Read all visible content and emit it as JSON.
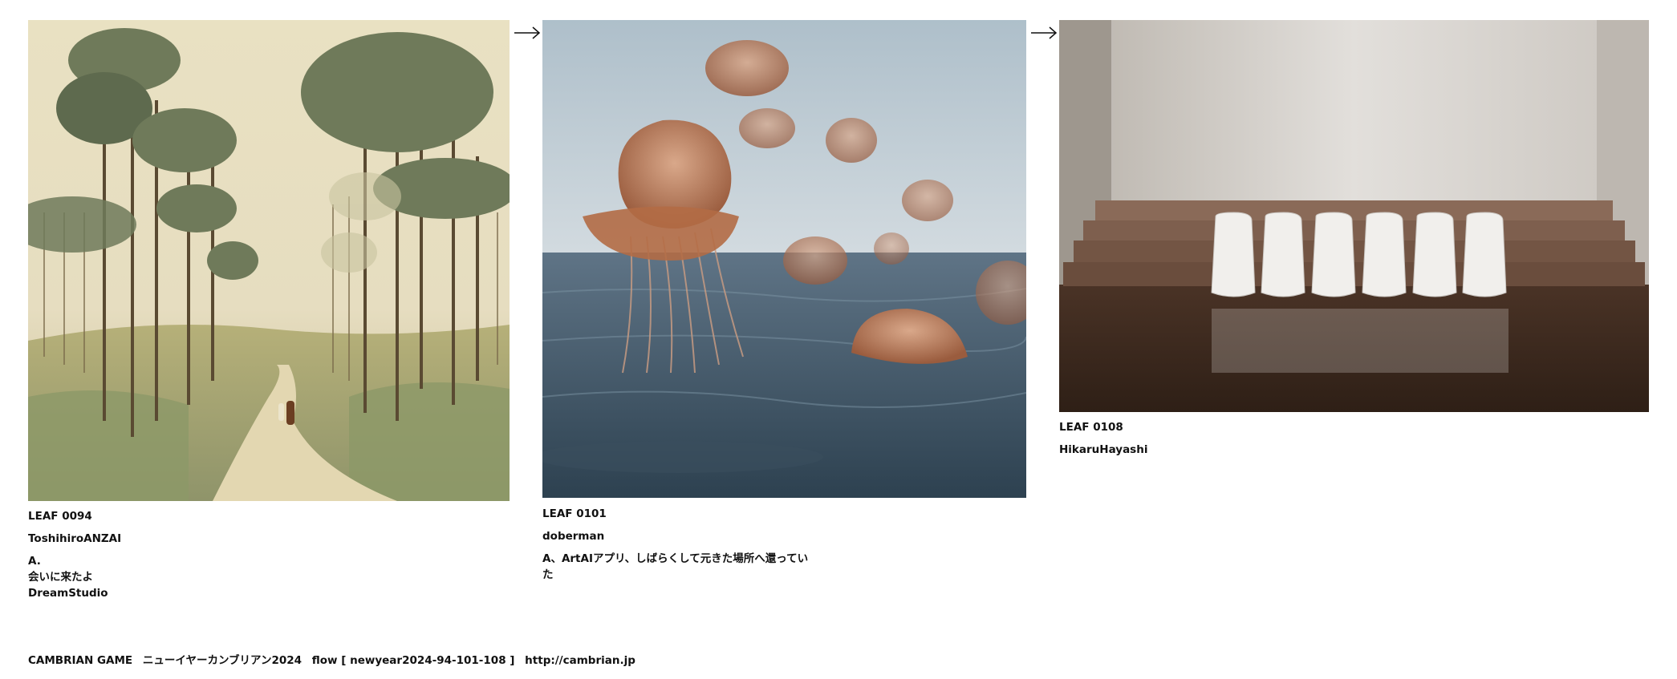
{
  "leaves": [
    {
      "id": "LEAF 0094",
      "author": "ToshihiroANZAI",
      "note_lines": [
        "A.",
        "会いに来たよ",
        "DreamStudio"
      ]
    },
    {
      "id": "LEAF 0101",
      "author": "doberman",
      "note_lines": [
        "A、ArtAIアプリ、しばらくして元きた場所へ還ってい",
        "た"
      ]
    },
    {
      "id": "LEAF 0108",
      "author": "HikaruHayashi",
      "note_lines": []
    }
  ],
  "arrows": [
    "→",
    "→"
  ],
  "footer": {
    "game": "CAMBRIAN GAME",
    "title": "ニューイヤーカンブリアン2024",
    "flow": "flow [ newyear2024-94-101-108 ]",
    "url": "http://cambrian.jp"
  }
}
